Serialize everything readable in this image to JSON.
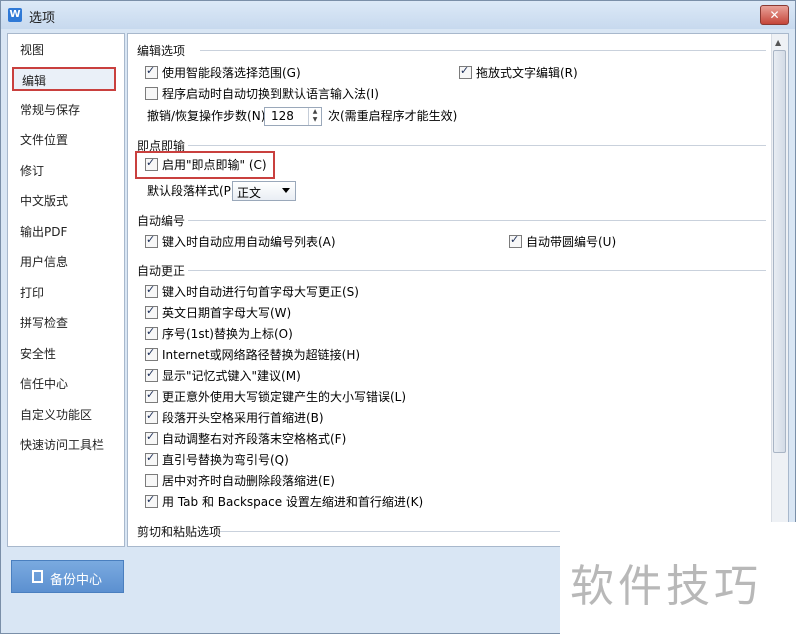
{
  "window": {
    "title": "选项",
    "app_icon": "W",
    "close": "✕"
  },
  "sidebar": {
    "items": [
      {
        "label": "视图"
      },
      {
        "label": "编辑"
      },
      {
        "label": "常规与保存"
      },
      {
        "label": "文件位置"
      },
      {
        "label": "修订"
      },
      {
        "label": "中文版式"
      },
      {
        "label": "输出PDF"
      },
      {
        "label": "用户信息"
      },
      {
        "label": "打印"
      },
      {
        "label": "拼写检查"
      },
      {
        "label": "安全性"
      },
      {
        "label": "信任中心"
      },
      {
        "label": "自定义功能区"
      },
      {
        "label": "快速访问工具栏"
      }
    ],
    "selected": "编辑",
    "backup_label": "备份中心"
  },
  "edit_options": {
    "heading": "编辑选项",
    "smart_select": {
      "label": "使用智能段落选择范围(G)",
      "checked": true
    },
    "drag_edit": {
      "label": "拖放式文字编辑(R)",
      "checked": true
    },
    "switch_ime": {
      "label": "程序启动时自动切换到默认语言输入法(I)",
      "checked": false
    },
    "undo_label": "撤销/恢复操作步数(N):",
    "undo_value": "128",
    "undo_note": "次(需重启程序才能生效)"
  },
  "click_type": {
    "heading": "即点即输",
    "enable": {
      "label": "启用\"即点即输\" (C)",
      "checked": true
    },
    "style_label": "默认段落样式(P):",
    "style_value": "正文"
  },
  "auto_number": {
    "heading": "自动编号",
    "apply_list": {
      "label": "键入时自动应用自动编号列表(A)",
      "checked": true
    },
    "circle_num": {
      "label": "自动带圆编号(U)",
      "checked": true
    }
  },
  "auto_correct": {
    "heading": "自动更正",
    "items": [
      {
        "label": "键入时自动进行句首字母大写更正(S)",
        "checked": true
      },
      {
        "label": "英文日期首字母大写(W)",
        "checked": true
      },
      {
        "label": "序号(1st)替换为上标(O)",
        "checked": true
      },
      {
        "label": "Internet或网络路径替换为超链接(H)",
        "checked": true
      },
      {
        "label": "显示\"记忆式键入\"建议(M)",
        "checked": true
      },
      {
        "label": "更正意外使用大写锁定键产生的大小写错误(L)",
        "checked": true
      },
      {
        "label": "段落开头空格采用行首缩进(B)",
        "checked": true
      },
      {
        "label": "自动调整右对齐段落末空格格式(F)",
        "checked": true
      },
      {
        "label": "直引号替换为弯引号(Q)",
        "checked": true
      },
      {
        "label": "居中对齐时自动删除段落缩进(E)",
        "checked": false
      },
      {
        "label": "用 Tab 和 Backspace 设置左缩进和首行缩进(K)",
        "checked": true
      }
    ]
  },
  "cut_paste": {
    "heading": "剪切和粘贴选项"
  },
  "watermark": "软件技巧"
}
